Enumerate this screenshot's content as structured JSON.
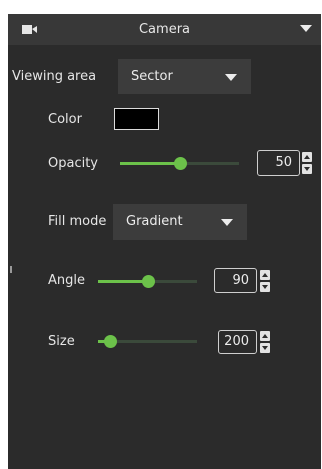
{
  "header": {
    "title": "Camera",
    "icon": "camera-icon"
  },
  "viewing_area": {
    "label": "Viewing area",
    "value": "Sector"
  },
  "color": {
    "label": "Color",
    "swatch": "#000000"
  },
  "opacity": {
    "label": "Opacity",
    "value": "50",
    "fraction": 0.5
  },
  "fill_mode": {
    "label": "Fill mode",
    "value": "Gradient"
  },
  "angle": {
    "label": "Angle",
    "value": "90",
    "fraction": 0.5
  },
  "size": {
    "label": "Size",
    "value": "200",
    "fraction": 0.12
  },
  "theme": {
    "panel_bg": "#2b2b2b",
    "header_bg": "#383838",
    "accent": "#6cc24a",
    "track": "#3b4a3b"
  }
}
